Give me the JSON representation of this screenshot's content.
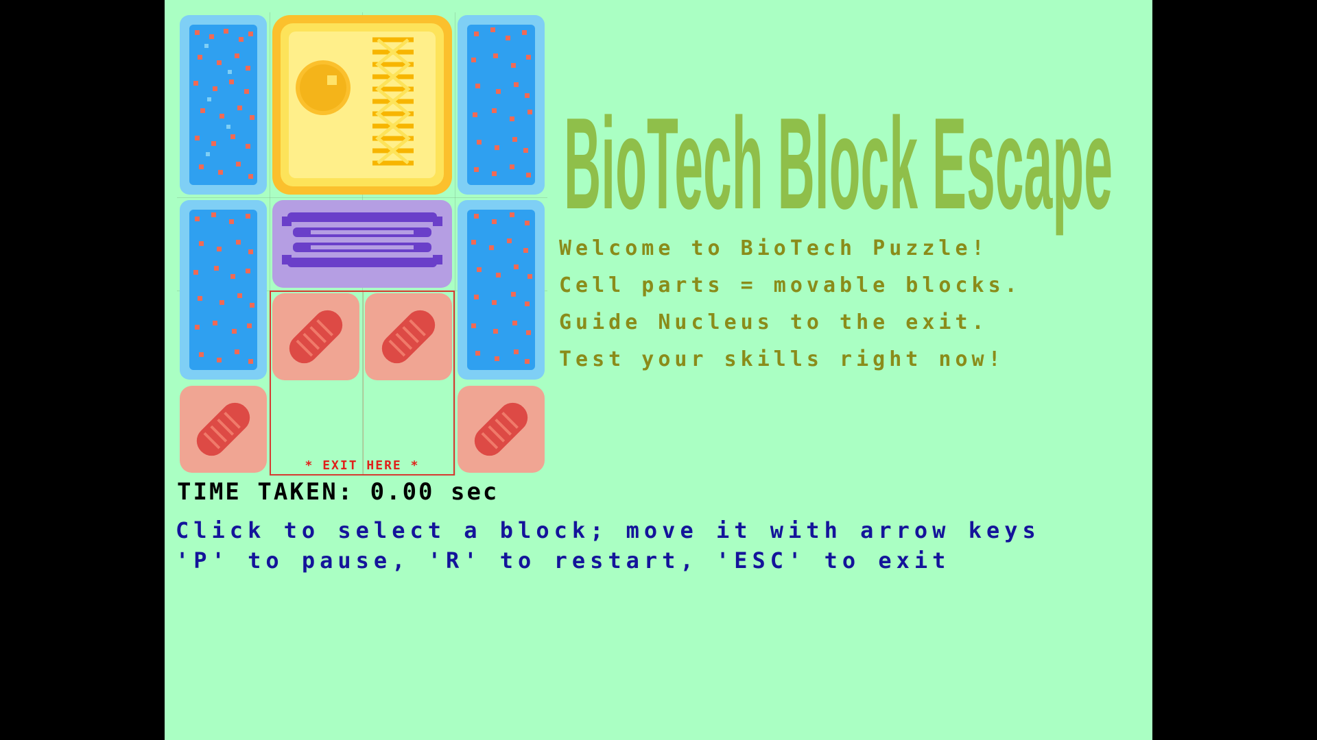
{
  "title": "BioTech Block Escape",
  "board": {
    "exit_label": "* EXIT HERE *",
    "blocks": [
      {
        "id": "ribosome-1",
        "type": "ribosome"
      },
      {
        "id": "nucleus",
        "type": "nucleus"
      },
      {
        "id": "ribosome-2",
        "type": "ribosome"
      },
      {
        "id": "golgi",
        "type": "golgi"
      },
      {
        "id": "ribosome-3",
        "type": "ribosome"
      },
      {
        "id": "ribosome-4",
        "type": "ribosome"
      },
      {
        "id": "mito-1",
        "type": "mitochondrion"
      },
      {
        "id": "mito-2",
        "type": "mitochondrion"
      },
      {
        "id": "mito-3",
        "type": "mitochondrion"
      },
      {
        "id": "mito-4",
        "type": "mitochondrion"
      }
    ]
  },
  "intro": {
    "line1": "Welcome to BioTech Puzzle!",
    "line2": "Cell parts = movable blocks.",
    "line3": "Guide Nucleus to the exit.",
    "line4": "Test your skills right now!"
  },
  "timer": {
    "text": "TIME TAKEN: 0.00 sec"
  },
  "help": {
    "line1": "Click to select a block; move it with arrow keys",
    "line2": "'P' to pause, 'R' to restart, 'ESC' to exit"
  },
  "colors": {
    "background": "#aaffc3",
    "ribosome_bg": "#7fcff5",
    "ribosome_fg": "#2fa0f0",
    "nucleus_bg": "#fde35a",
    "nucleus_fg": "#fbc02d",
    "golgi_bg": "#b59ee3",
    "golgi_fg": "#6a3fc9",
    "mito_bg": "#f0a593",
    "mito_fg": "#dd4a45",
    "intro_text": "#8a8c1a",
    "title_text": "#8fbf4a",
    "help_text": "#14149a",
    "exit_text": "#e0201b"
  }
}
